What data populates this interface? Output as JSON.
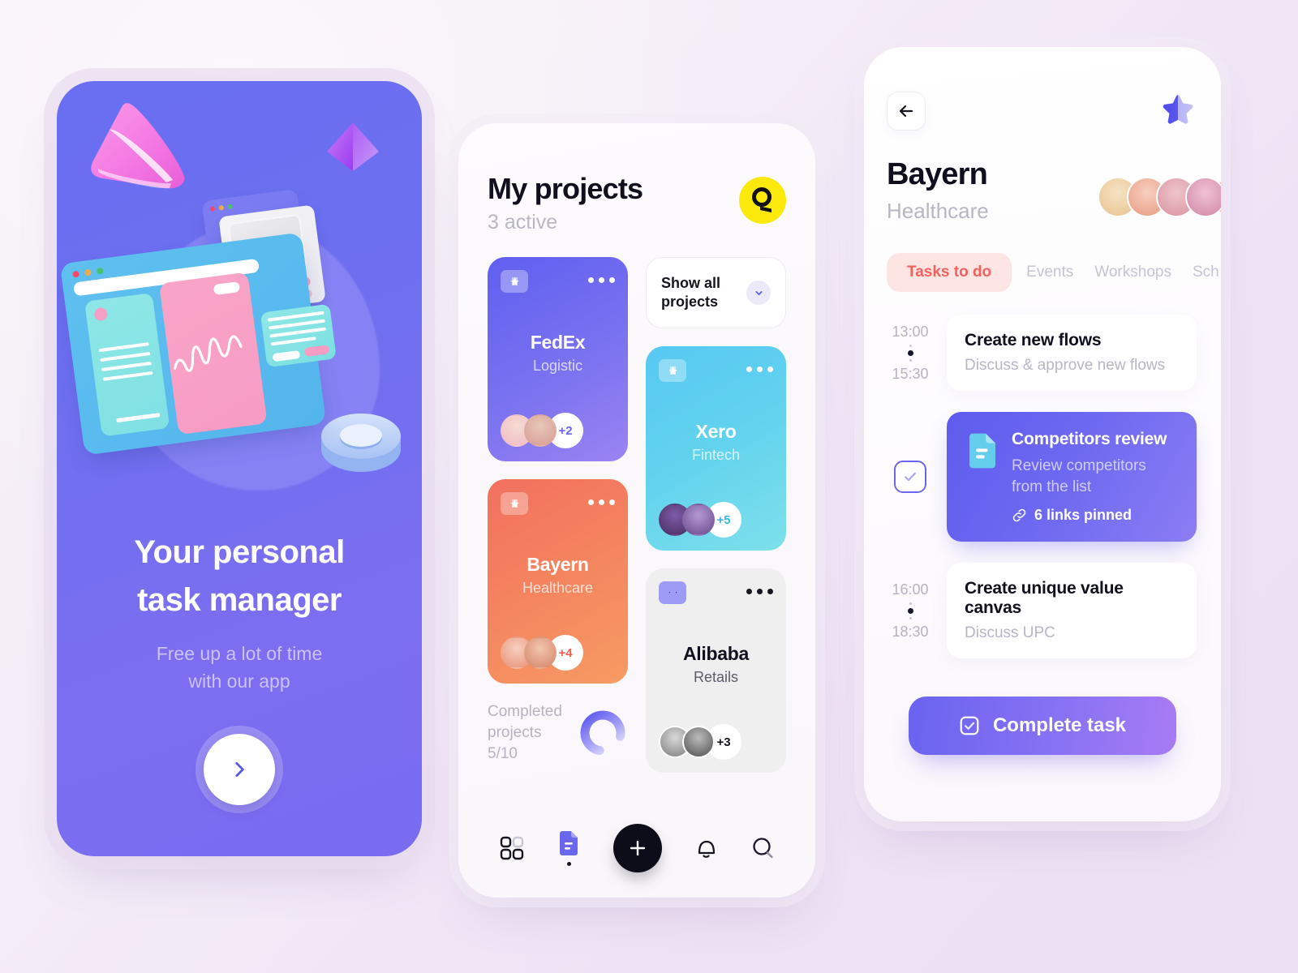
{
  "screen1": {
    "headline_line1": "Your personal",
    "headline_line2": "task manager",
    "subtitle_line1": "Free up a lot of time",
    "subtitle_line2": "with our app",
    "next_icon": "chevron-right-icon"
  },
  "screen2": {
    "title": "My projects",
    "subtitle": "3 active",
    "logo_text": "Q",
    "logo_color": "#fbe90b",
    "show_all": {
      "label_line1": "Show all",
      "label_line2": "projects",
      "chevron": "chevron-down-icon"
    },
    "projects": [
      {
        "name": "FedEx",
        "category": "Logistic",
        "more_count": "+2",
        "theme": "fedex"
      },
      {
        "name": "Xero",
        "category": "Fintech",
        "more_count": "+5",
        "theme": "xero"
      },
      {
        "name": "Bayern",
        "category": "Healthcare",
        "more_count": "+4",
        "theme": "bayern"
      },
      {
        "name": "Alibaba",
        "category": "Retails",
        "more_count": "+3",
        "theme": "alibaba"
      }
    ],
    "completed": {
      "label_line1": "Completed",
      "label_line2": "projects 5/10",
      "progress_percent": 50
    },
    "nav": [
      {
        "name": "grid-icon"
      },
      {
        "name": "document-icon"
      },
      {
        "name": "plus-icon"
      },
      {
        "name": "bell-icon"
      },
      {
        "name": "search-icon"
      }
    ]
  },
  "screen3": {
    "back_icon": "arrow-left-icon",
    "favorite_icon": "star-icon",
    "project_name": "Bayern",
    "project_category": "Healthcare",
    "add_member_label": "+",
    "tabs": [
      {
        "label": "Tasks to do",
        "active": true
      },
      {
        "label": "Events",
        "active": false
      },
      {
        "label": "Workshops",
        "active": false
      },
      {
        "label": "Sch",
        "active": false
      }
    ],
    "tasks": [
      {
        "start": "13:00",
        "end": "15:30",
        "title": "Create new flows",
        "desc": "Discuss & approve new flows",
        "style": "plain",
        "marker": "dots"
      },
      {
        "start": "",
        "end": "",
        "title": "Competitors review",
        "desc_line1": "Review competitors",
        "desc_line2": "from the list",
        "links_label": "6 links pinned",
        "links_icon": "link-icon",
        "doc_icon": "document-icon",
        "style": "highlight",
        "marker": "checkbox"
      },
      {
        "start": "16:00",
        "end": "18:30",
        "title": "Create unique value canvas",
        "desc": "Discuss UPC",
        "style": "plain",
        "marker": "dots"
      }
    ],
    "complete_button": {
      "label": "Complete task",
      "icon": "check-square-icon"
    }
  },
  "colors": {
    "accent_purple": "#6a63f0",
    "accent_red": "#f4615c",
    "accent_yellow": "#fbe90b",
    "page_bg": "#f2eaf6"
  }
}
